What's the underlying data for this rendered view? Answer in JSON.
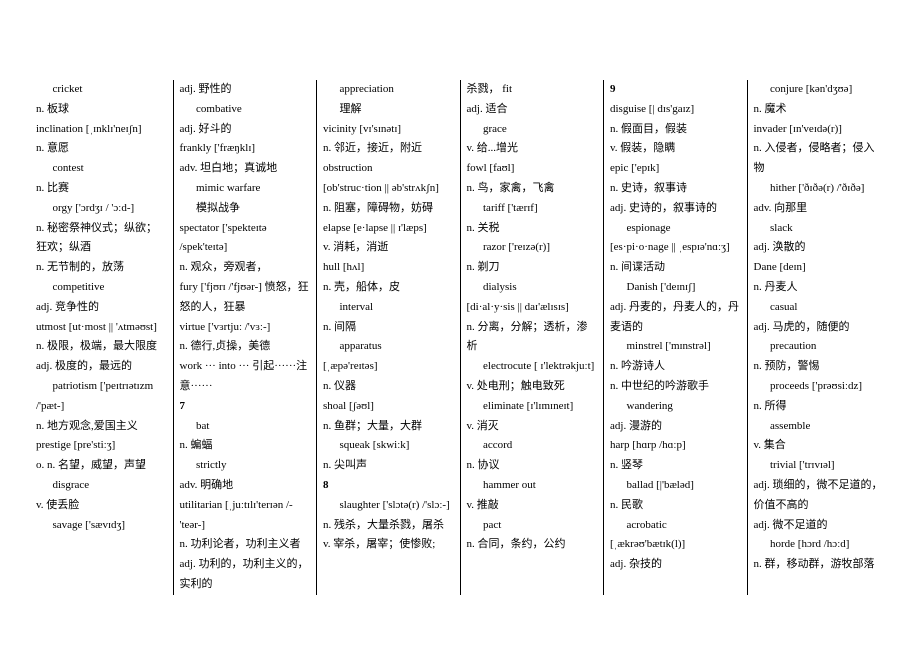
{
  "columns": [
    [
      {
        "t": "entry",
        "v": "cricket"
      },
      {
        "t": "def",
        "v": "n.  板球"
      },
      {
        "t": "def",
        "v": "inclination  [ˌɪnklɪ'neɪʃn]"
      },
      {
        "t": "def",
        "v": "n.  意愿"
      },
      {
        "t": "entry",
        "v": "contest"
      },
      {
        "t": "def",
        "v": "n.  比赛"
      },
      {
        "t": "entry",
        "v": "orgy  ['ɔrdʒɪ / 'ɔːd-]"
      },
      {
        "t": "def",
        "v": "n.  秘密祭神仪式；纵欲；狂欢；纵酒"
      },
      {
        "t": "def",
        "v": "n.  无节制的，放荡"
      },
      {
        "t": "entry",
        "v": "competitive"
      },
      {
        "t": "def",
        "v": "adj. 竞争性的"
      },
      {
        "t": "def",
        "v": "utmost  [ut·most || 'ʌtməʊst]"
      },
      {
        "t": "def",
        "v": "n.  极限，极端，最大限度"
      },
      {
        "t": "def",
        "v": "adj. 极度的，最远的"
      },
      {
        "t": "entry",
        "v": "patriotism  ['peɪtrɪətɪzm /'pæt-]"
      },
      {
        "t": "def",
        "v": "n.  地方观念,爱国主义"
      },
      {
        "t": "def",
        "v": "prestige [pre'stiːʒ]"
      },
      {
        "t": "def",
        "v": "o. n.  名望，威望，声望"
      },
      {
        "t": "entry",
        "v": "disgrace"
      },
      {
        "t": "def",
        "v": "v.  使丢脸"
      },
      {
        "t": "entry",
        "v": "savage  ['sævɪdʒ]"
      }
    ],
    [
      {
        "t": "def",
        "v": "adj. 野性的"
      },
      {
        "t": "entry",
        "v": "combative"
      },
      {
        "t": "def",
        "v": "adj. 好斗的"
      },
      {
        "t": "def",
        "v": "frankly  ['fræŋklɪ]"
      },
      {
        "t": "def",
        "v": "adv. 坦白地；真诚地"
      },
      {
        "t": "entry",
        "v": "mimic warfare"
      },
      {
        "t": "entry",
        "v": "模拟战争"
      },
      {
        "t": "def",
        "v": "spectator  ['spekteɪtə /spek'teɪtə]"
      },
      {
        "t": "def",
        "v": "n.  观众，旁观者，"
      },
      {
        "t": "def",
        "v": "fury  ['fjʊrɪ /'fjʊər-] 愤怒，狂怒的人，狂暴"
      },
      {
        "t": "def",
        "v": "virtue ['vɜrtjuː /'vɜː-]"
      },
      {
        "t": "def",
        "v": "n.  德行,贞操，美德"
      },
      {
        "t": "def",
        "v": "work  ···  into  ··· 引起······注意······"
      },
      {
        "t": "hd",
        "v": "7"
      },
      {
        "t": "entry",
        "v": "bat"
      },
      {
        "t": "def",
        "v": "n.  蝙蝠"
      },
      {
        "t": "entry",
        "v": "strictly"
      },
      {
        "t": "def",
        "v": "adv. 明确地"
      },
      {
        "t": "def",
        "v": "utilitarian  [ˌjuːtɪlɪ'terɪən /-'teər-]"
      },
      {
        "t": "def",
        "v": "n.  功利论者，功利主义者"
      },
      {
        "t": "def",
        "v": "adj. 功利的，功利主义的，实利的"
      }
    ],
    [
      {
        "t": "entry",
        "v": "appreciation"
      },
      {
        "t": "entry",
        "v": "理解"
      },
      {
        "t": "def",
        "v": "vicinity  [vɪ'sɪnətɪ]"
      },
      {
        "t": "def",
        "v": "n.  邻近，接近，附近"
      },
      {
        "t": "def",
        "v": "obstruction"
      },
      {
        "t": "def",
        "v": "[ob'struc·tion || əb'strʌkʃn]"
      },
      {
        "t": "def",
        "v": "n.  阻塞，障碍物，妨碍"
      },
      {
        "t": "def",
        "v": "elapse  [e·lapse || ɪ'læps]"
      },
      {
        "t": "def",
        "v": "v.  消耗，消逝"
      },
      {
        "t": "def",
        "v": "hull  [hʌl]"
      },
      {
        "t": "def",
        "v": "n.  壳，船体，皮"
      },
      {
        "t": "entry",
        "v": "interval"
      },
      {
        "t": "def",
        "v": "n.  间隔"
      },
      {
        "t": "entry",
        "v": "apparatus"
      },
      {
        "t": "def",
        "v": "[ˌæpə'reɪtəs]"
      },
      {
        "t": "def",
        "v": "n.  仪器"
      },
      {
        "t": "def",
        "v": "shoal  [ʃəʊl]"
      },
      {
        "t": "def",
        "v": "n. 鱼群；大量，大群"
      },
      {
        "t": "entry",
        "v": "squeak  [skwiːk]"
      },
      {
        "t": "def",
        "v": "n.  尖叫声"
      },
      {
        "t": "hd",
        "v": "8"
      },
      {
        "t": "entry",
        "v": "slaughter  ['slɔtə(r) /'slɔː-]"
      },
      {
        "t": "def",
        "v": "n.  残杀，大量杀戮，屠杀"
      },
      {
        "t": "def",
        "v": "v.  宰杀，屠宰；使惨败;"
      }
    ],
    [
      {
        "t": "def",
        "v": "杀戮，  fit"
      },
      {
        "t": "def",
        "v": "adj. 适合"
      },
      {
        "t": "entry",
        "v": "grace"
      },
      {
        "t": "def",
        "v": "v.  给...增光"
      },
      {
        "t": "def",
        "v": "fowl  [faʊl]"
      },
      {
        "t": "def",
        "v": "n.  鸟，家禽，飞禽"
      },
      {
        "t": "entry",
        "v": "tariff  ['tærɪf]"
      },
      {
        "t": "def",
        "v": "n.  关税"
      },
      {
        "t": "entry",
        "v": "razor  ['reɪzə(r)]"
      },
      {
        "t": "def",
        "v": "n.  剃刀"
      },
      {
        "t": "entry",
        "v": "dialysis"
      },
      {
        "t": "def",
        "v": "[di·al·y·sis || daɪ'ælɪsɪs]"
      },
      {
        "t": "def",
        "v": "n.  分离，分解；透析，渗析"
      },
      {
        "t": "entry",
        "v": "electrocute  [ ɪ'lektrəkjuːt]"
      },
      {
        "t": "def",
        "v": "v.  处电刑；触电致死"
      },
      {
        "t": "entry",
        "v": "eliminate  [ɪ'lɪmɪneɪt]"
      },
      {
        "t": "def",
        "v": "v.  消灭"
      },
      {
        "t": "entry",
        "v": "accord"
      },
      {
        "t": "def",
        "v": "n.  协议"
      },
      {
        "t": "entry",
        "v": "hammer out"
      },
      {
        "t": "def",
        "v": "v.  推敲"
      },
      {
        "t": "entry",
        "v": "pact"
      },
      {
        "t": "def",
        "v": "n.  合同，条约，公约"
      }
    ],
    [
      {
        "t": "hd",
        "v": "9"
      },
      {
        "t": "def",
        "v": "disguise  [| dɪs'gaɪz]"
      },
      {
        "t": "def",
        "v": "n.  假面目，假装"
      },
      {
        "t": "def",
        "v": "v.  假装，隐瞒"
      },
      {
        "t": "def",
        "v": "epic  ['epɪk]"
      },
      {
        "t": "def",
        "v": "n.  史诗，叙事诗"
      },
      {
        "t": "def",
        "v": "adj. 史诗的，叙事诗的"
      },
      {
        "t": "entry",
        "v": "espionage"
      },
      {
        "t": "def",
        "v": "[es·pi·o·nage || ˌespɪə'nɑːʒ]"
      },
      {
        "t": "def",
        "v": "n.  间谍活动"
      },
      {
        "t": "entry",
        "v": "Danish  ['deɪnɪʃ]"
      },
      {
        "t": "def",
        "v": "adj. 丹麦的，丹麦人的，丹麦语的"
      },
      {
        "t": "entry",
        "v": "minstrel  ['mɪnstrəl]"
      },
      {
        "t": "def",
        "v": "n.  吟游诗人"
      },
      {
        "t": "def",
        "v": "n.  中世纪的吟游歌手"
      },
      {
        "t": "entry",
        "v": "wandering"
      },
      {
        "t": "def",
        "v": "adj. 漫游的"
      },
      {
        "t": "def",
        "v": "harp  [hɑrp /hɑːp]"
      },
      {
        "t": "def",
        "v": "n.  竖琴"
      },
      {
        "t": "entry",
        "v": "ballad  [|'bæləd]"
      },
      {
        "t": "def",
        "v": "n.  民歌"
      },
      {
        "t": "entry",
        "v": "acrobatic  [ˌækrəʊ'bætɪk(l)]"
      },
      {
        "t": "def",
        "v": "adj. 杂技的"
      }
    ],
    [
      {
        "t": "entry",
        "v": "conjure  [kən'dʒʊə]"
      },
      {
        "t": "def",
        "v": "n.  魔术"
      },
      {
        "t": "def",
        "v": "invader  [ɪn'veɪdə(r)]"
      },
      {
        "t": "def",
        "v": "n.  入侵者，侵略者；侵入物"
      },
      {
        "t": "entry",
        "v": "hither  ['ðɪðə(r) /'ðɪðə]"
      },
      {
        "t": "def",
        "v": "adv. 向那里"
      },
      {
        "t": "entry",
        "v": "slack"
      },
      {
        "t": "def",
        "v": "adj. 涣散的"
      },
      {
        "t": "def",
        "v": "Dane  [deɪn]"
      },
      {
        "t": "def",
        "v": "n.  丹麦人"
      },
      {
        "t": "entry",
        "v": "casual"
      },
      {
        "t": "def",
        "v": "adj. 马虎的，随便的"
      },
      {
        "t": "entry",
        "v": "precaution"
      },
      {
        "t": "def",
        "v": "n.  预防，警惕"
      },
      {
        "t": "entry",
        "v": "proceeds  ['prəʊsiːdz]"
      },
      {
        "t": "def",
        "v": "n.  所得"
      },
      {
        "t": "entry",
        "v": "assemble"
      },
      {
        "t": "def",
        "v": "v.  集合"
      },
      {
        "t": "entry",
        "v": "trivial  ['trɪvɪəl]"
      },
      {
        "t": "def",
        "v": "adj. 琐细的，微不足道的，价值不高的"
      },
      {
        "t": "def",
        "v": "adj. 微不足道的"
      },
      {
        "t": "entry",
        "v": "horde  [hɔrd /hɔːd]"
      },
      {
        "t": "def",
        "v": "n.  群，移动群，游牧部落"
      }
    ]
  ]
}
